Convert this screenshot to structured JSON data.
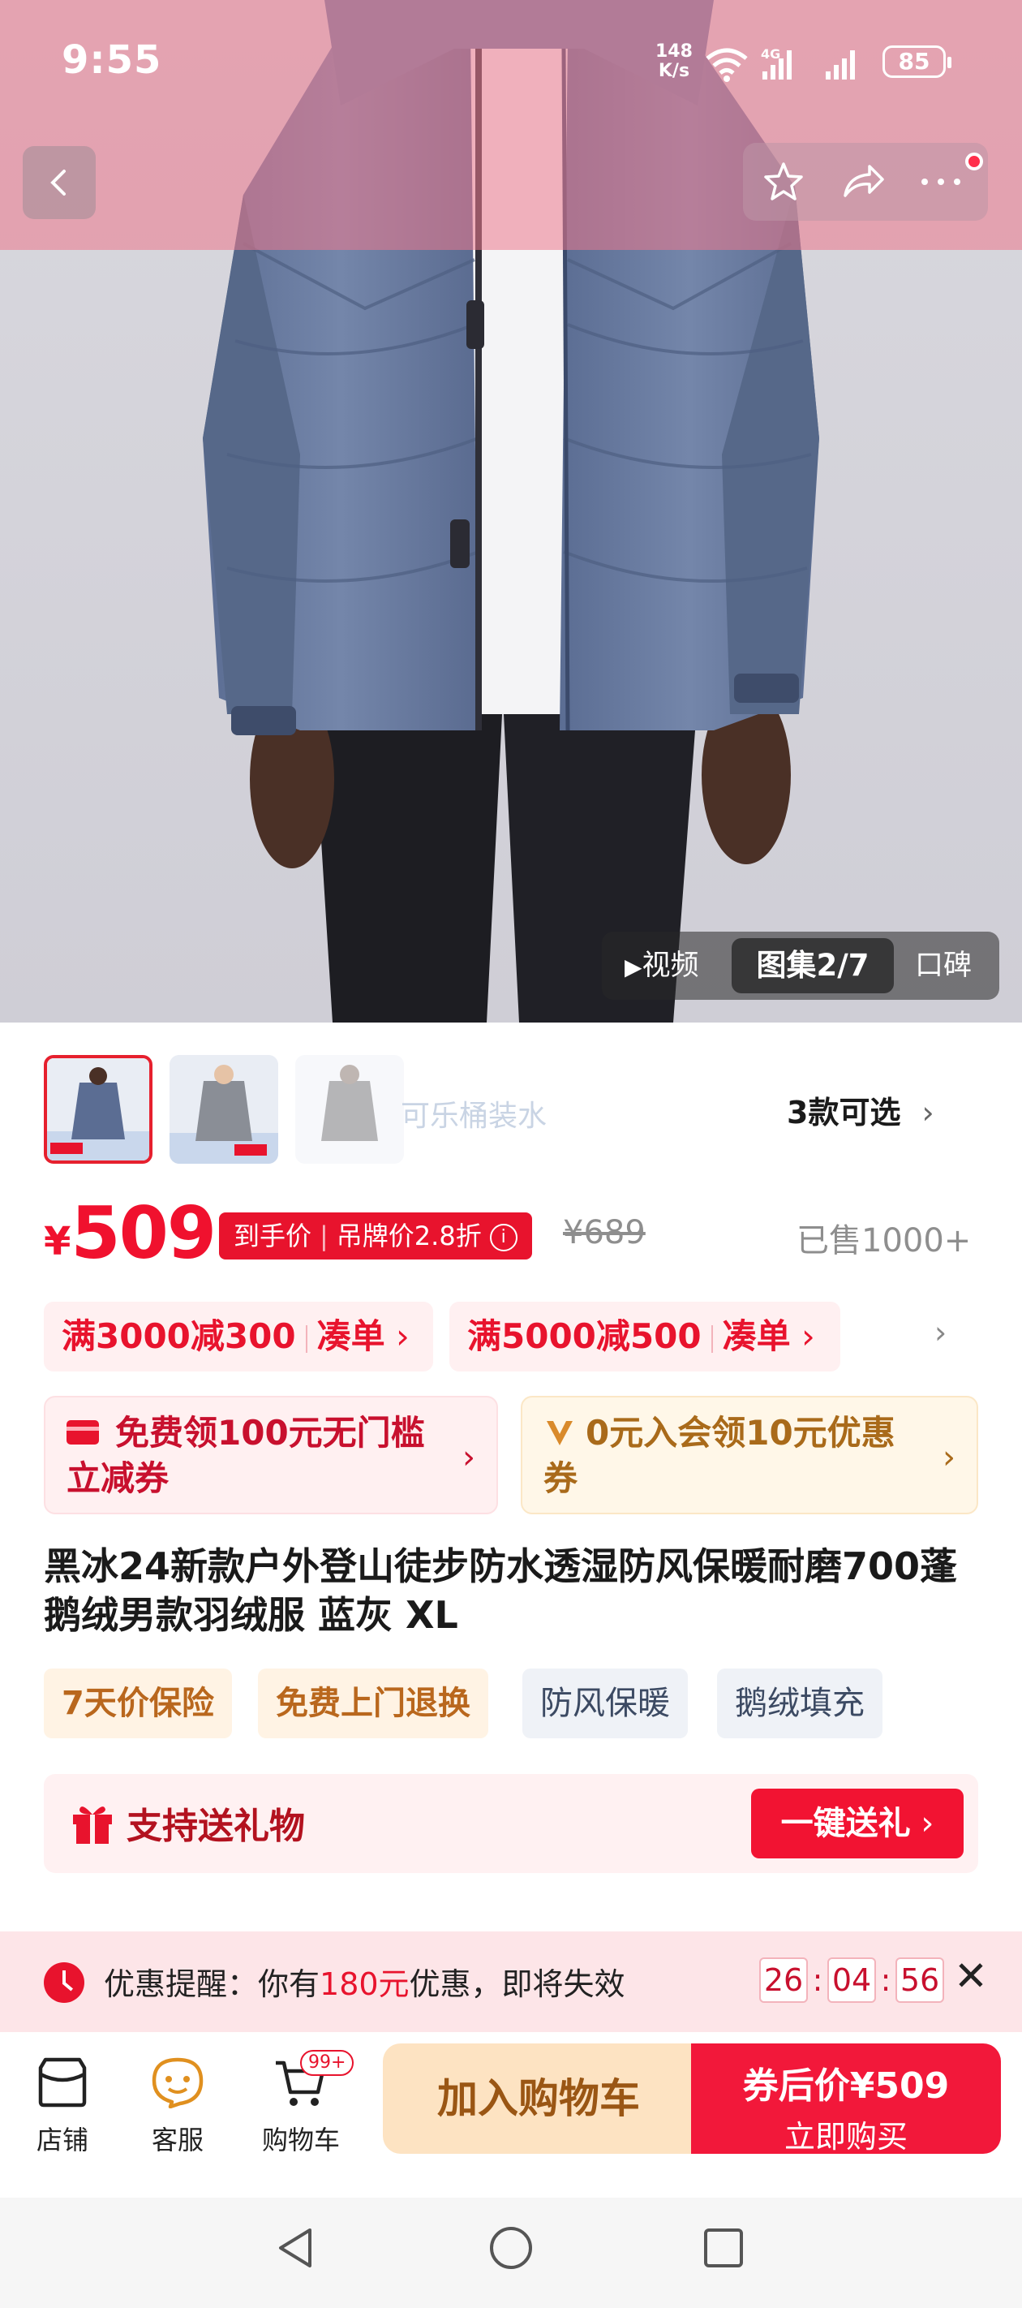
{
  "status_bar": {
    "time": "9:55",
    "net_speed_value": "148",
    "net_speed_unit": "K/s",
    "network": "4G",
    "battery": "85"
  },
  "gallery": {
    "video_label": "视频",
    "album_label": "图集2/7",
    "review_label": "口碑"
  },
  "variants": {
    "watermark": "可乐桶装水",
    "count_label": "3款可选"
  },
  "price": {
    "currency": "¥",
    "value": "509",
    "badge_final": "到手价",
    "badge_discount": "吊牌价2.8折",
    "original": "¥689",
    "sold": "已售1000+"
  },
  "promos": [
    {
      "label": "满3000减300",
      "action": "凑单"
    },
    {
      "label": "满5000减500",
      "action": "凑单"
    }
  ],
  "coupons": {
    "free_coupon": "免费领100元无门槛立减券",
    "member_coupon": "0元入会领10元优惠券"
  },
  "product": {
    "title": "黑冰24新款户外登山徒步防水透湿防风保暖耐磨700蓬鹅绒男款羽绒服 蓝灰 XL",
    "tags": [
      "7天价保险",
      "免费上门退换",
      "防风保暖",
      "鹅绒填充"
    ]
  },
  "gift": {
    "label": "支持送礼物",
    "button": "一键送礼"
  },
  "reminder": {
    "prefix": "优惠提醒：你有",
    "amount": "180元",
    "suffix": "优惠，即将失效",
    "timer": [
      "26",
      "04",
      "56"
    ]
  },
  "actions": {
    "store": "店铺",
    "service": "客服",
    "cart": "购物车",
    "cart_badge": "99+",
    "add_to_cart": "加入购物车",
    "buy_price": "券后价¥509",
    "buy_now": "立即购买"
  },
  "colors": {
    "accent_red": "#f2183a",
    "price_red": "#f0112e",
    "gold_text": "#9a5614"
  }
}
